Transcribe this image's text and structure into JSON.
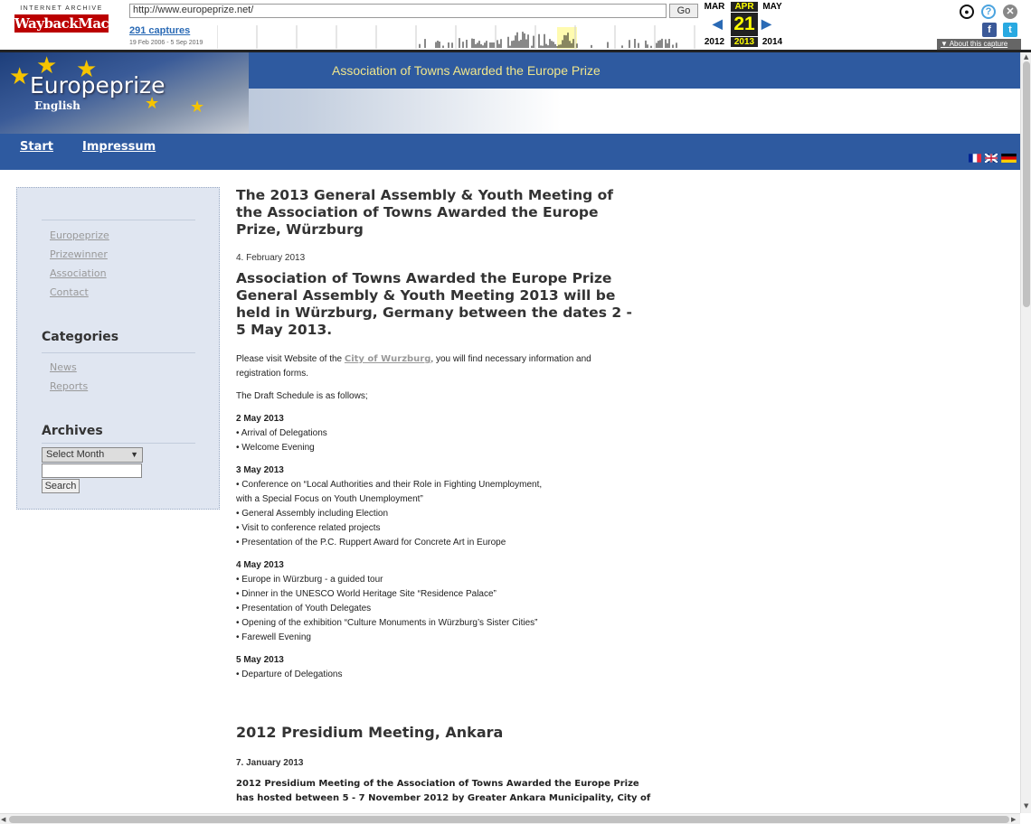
{
  "wayback": {
    "logo_top": "INTERNET ARCHIVE",
    "logo_main": "WaybackMachine",
    "url": "http://www.europeprize.net/",
    "go_label": "Go",
    "captures": "291 captures",
    "range": "19 Feb 2006 - 5 Sep 2019",
    "months": {
      "prev": "MAR",
      "cur": "APR",
      "next": "MAY"
    },
    "day": "21",
    "years": {
      "prev": "2012",
      "cur": "2013",
      "next": "2014"
    },
    "about": "About this capture"
  },
  "site": {
    "title": "Europeprize",
    "language": "English",
    "tagline": "Association of Towns Awarded the Europe Prize"
  },
  "nav": {
    "start": "Start",
    "impressum": "Impressum"
  },
  "sidebar": {
    "links": [
      "Europeprize",
      "Prizewinner",
      "Association",
      "Contact"
    ],
    "categories_heading": "Categories",
    "categories": [
      "News",
      "Reports"
    ],
    "archives_heading": "Archives",
    "select_value": "Select Month",
    "search_label": "Search"
  },
  "article1": {
    "title": "The 2013 General Assembly & Youth Meeting of the Association of Towns Awarded the Europe Prize, Würzburg",
    "date": "4. February 2013",
    "subtitle": "Association of Towns Awarded the Europe Prize General Assembly & Youth Meeting 2013 will be held in Würzburg, Germany between the dates 2 - 5 May 2013.",
    "visit_before": "Please visit Website of the ",
    "visit_link": "City of Wurzburg",
    "visit_after": ", you will find necessary information and registration forms.",
    "schedule_intro": "The Draft Schedule is as follows;",
    "days": [
      {
        "date": "2 May 2013",
        "items": [
          "• Arrival of Delegations",
          "• Welcome Evening"
        ]
      },
      {
        "date": "3 May 2013",
        "items": [
          "• Conference on “Local Authorities and their Role in Fighting Unemployment,",
          "with a Special Focus on Youth Unemployment”",
          "• General Assembly including Election",
          "• Visit to conference related projects",
          "• Presentation of the P.C. Ruppert Award for Concrete Art in Europe"
        ]
      },
      {
        "date": "4 May 2013",
        "items": [
          "• Europe in Würzburg - a guided tour",
          "• Dinner in the UNESCO World Heritage Site “Residence Palace”",
          "• Presentation of Youth Delegates",
          "• Opening of the exhibition “Culture Monuments in Würzburg’s Sister Cities”",
          "• Farewell Evening"
        ]
      },
      {
        "date": "5 May 2013",
        "items": [
          "• Departure of Delegations"
        ]
      }
    ]
  },
  "article2": {
    "title": "2012 Presidium Meeting, Ankara",
    "date": "7. January 2013",
    "text_line1": "2012 Presidium Meeting of the Association of Towns Awarded the Europe Prize",
    "text_line2": "has hosted between 5 - 7 November 2012 by Greater Ankara Municipality, City of"
  },
  "colors": {
    "banner": "#2e5aa0",
    "sidebar": "#e0e6f1",
    "tagline": "#f0e68c"
  }
}
